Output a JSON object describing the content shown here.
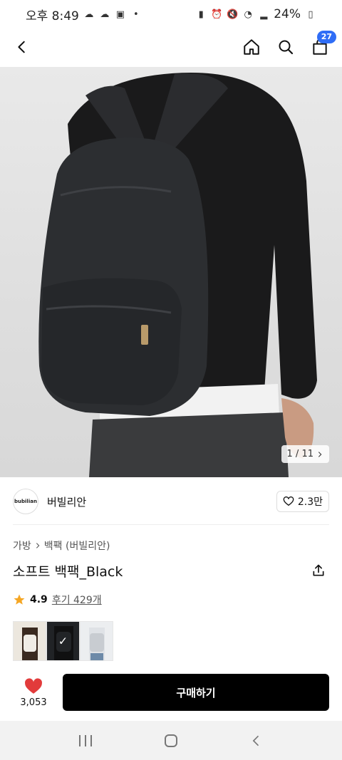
{
  "status_bar": {
    "time": "오후 8:49",
    "battery": "24%"
  },
  "top_nav": {
    "cart_count": "27"
  },
  "hero": {
    "image_counter": "1 / 11"
  },
  "brand": {
    "logo_text": "bubilian",
    "name": "버빌리안",
    "likes": "2.3만"
  },
  "breadcrumb": {
    "items": [
      "가방",
      "백팩 (버빌리안)"
    ]
  },
  "product": {
    "title": "소프트 백팩_Black",
    "rating": "4.9",
    "review_label": "후기 429개"
  },
  "color_options": [
    {
      "color": "#ece7de"
    },
    {
      "color": "#1d1f22"
    },
    {
      "color": "#d7d9dc"
    }
  ],
  "buy_bar": {
    "wish_count": "3,053",
    "buy_label": "구매하기"
  },
  "colors": {
    "accent": "#2f6df6",
    "heart": "#e23b3b",
    "star": "#f5a623"
  }
}
